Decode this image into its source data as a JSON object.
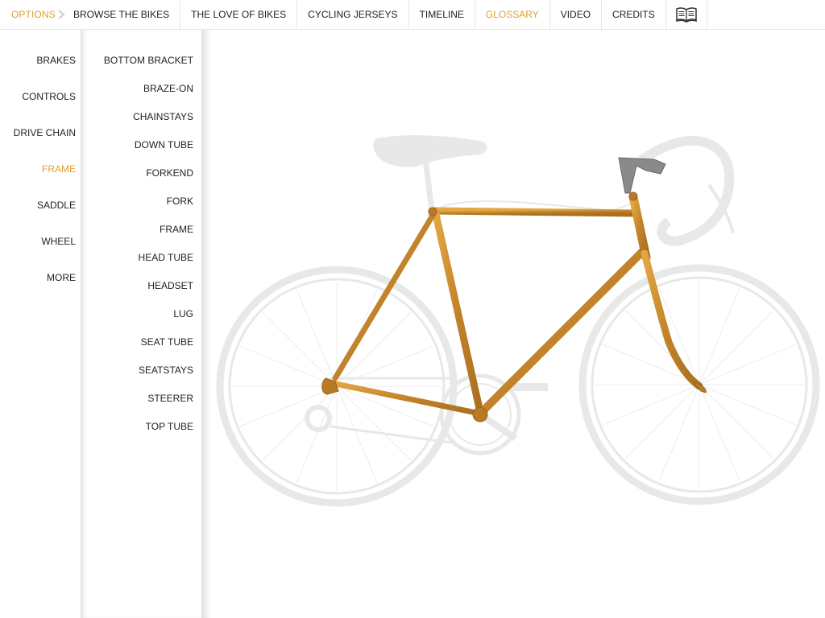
{
  "topbar": {
    "options_label": "OPTIONS",
    "nav": [
      {
        "label": "BROWSE THE BIKES",
        "active": false
      },
      {
        "label": "THE LOVE OF BIKES",
        "active": false
      },
      {
        "label": "CYCLING JERSEYS",
        "active": false
      },
      {
        "label": "TIMELINE",
        "active": false
      },
      {
        "label": "GLOSSARY",
        "active": true
      },
      {
        "label": "VIDEO",
        "active": false
      },
      {
        "label": "CREDITS",
        "active": false
      }
    ],
    "book_icon": "open-book-icon"
  },
  "categories": [
    {
      "label": "BRAKES",
      "active": false
    },
    {
      "label": "CONTROLS",
      "active": false
    },
    {
      "label": "DRIVE CHAIN",
      "active": false
    },
    {
      "label": "FRAME",
      "active": true
    },
    {
      "label": "SADDLE",
      "active": false
    },
    {
      "label": "WHEEL",
      "active": false
    },
    {
      "label": "MORE",
      "active": false
    }
  ],
  "terms": [
    {
      "label": "BOTTOM BRACKET"
    },
    {
      "label": "BRAZE-ON"
    },
    {
      "label": "CHAINSTAYS"
    },
    {
      "label": "DOWN TUBE"
    },
    {
      "label": "FORKEND"
    },
    {
      "label": "FORK"
    },
    {
      "label": "FRAME"
    },
    {
      "label": "HEAD TUBE"
    },
    {
      "label": "HEADSET"
    },
    {
      "label": "LUG"
    },
    {
      "label": "SEAT TUBE"
    },
    {
      "label": "SEATSTAYS"
    },
    {
      "label": "STEERER"
    },
    {
      "label": "TOP TUBE"
    }
  ],
  "colors": {
    "accent": "#e0a02c",
    "frame_gold": "#c98a2a",
    "ghost": "#e9e9e9"
  }
}
